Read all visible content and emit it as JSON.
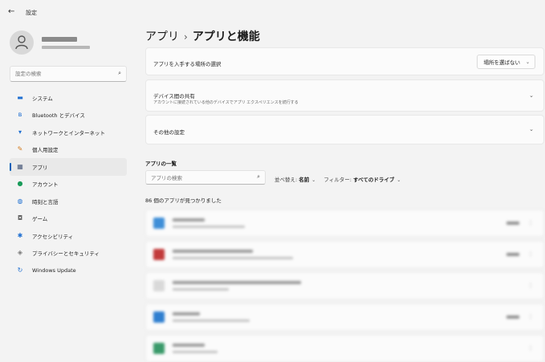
{
  "titlebar": {
    "back": "←",
    "title": "設定"
  },
  "sidebar": {
    "search_placeholder": "設定の検索",
    "items": [
      {
        "label": "システム",
        "icon": "monitor-icon",
        "glyph": "▬",
        "color": "#1f6fd1"
      },
      {
        "label": "Bluetooth とデバイス",
        "icon": "bluetooth-icon",
        "glyph": "ʙ",
        "color": "#1f6fd1"
      },
      {
        "label": "ネットワークとインターネット",
        "icon": "wifi-icon",
        "glyph": "▾",
        "color": "#1f6fd1"
      },
      {
        "label": "個人用設定",
        "icon": "brush-icon",
        "glyph": "✎",
        "color": "#d47a1c"
      },
      {
        "label": "アプリ",
        "icon": "apps-icon",
        "glyph": "▦",
        "color": "#4a5a7a",
        "active": true
      },
      {
        "label": "アカウント",
        "icon": "person-icon",
        "glyph": "●",
        "color": "#1a9b5a"
      },
      {
        "label": "時刻と言語",
        "icon": "globe-clock-icon",
        "glyph": "◍",
        "color": "#1f6fd1"
      },
      {
        "label": "ゲーム",
        "icon": "controller-icon",
        "glyph": "◘",
        "color": "#666666"
      },
      {
        "label": "アクセシビリティ",
        "icon": "accessibility-icon",
        "glyph": "✱",
        "color": "#1f6fd1"
      },
      {
        "label": "プライバシーとセキュリティ",
        "icon": "shield-icon",
        "glyph": "◈",
        "color": "#777777"
      },
      {
        "label": "Windows Update",
        "icon": "update-icon",
        "glyph": "↻",
        "color": "#1f6fd1"
      }
    ]
  },
  "breadcrumb": {
    "parent": "アプリ",
    "separator": "›",
    "current": "アプリと機能"
  },
  "cards": {
    "install_source": {
      "title": "アプリを入手する場所の選択",
      "dropdown_value": "場所を選ばない"
    },
    "share_across": {
      "title": "デバイス間の共有",
      "subtitle": "アカウントに接続されている他のデバイスでアプリ エクスペリエンスを続行する"
    },
    "more_settings": {
      "title": "その他の設定"
    }
  },
  "app_list": {
    "title": "アプリの一覧",
    "search_placeholder": "アプリの検索",
    "sort_label": "並べ替え:",
    "sort_value": "名前",
    "filter_label": "フィルター:",
    "filter_value": "すべてのドライブ",
    "count_text": "86 個のアプリが見つかりました"
  },
  "colors": {
    "accent": "#005fb8"
  }
}
